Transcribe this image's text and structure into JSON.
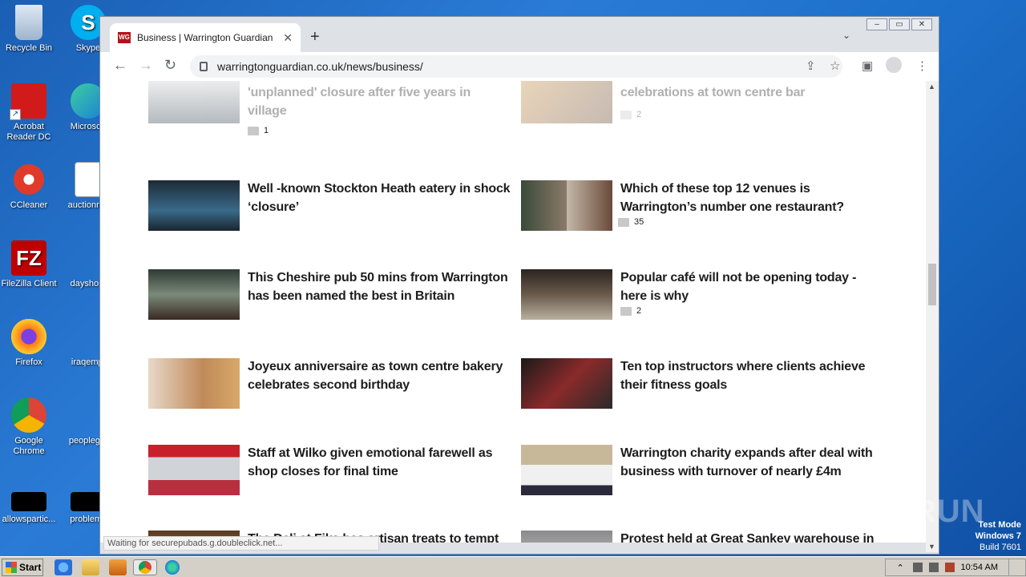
{
  "desktop": {
    "icons": [
      {
        "label": "Recycle Bin"
      },
      {
        "label": "Skype"
      },
      {
        "label": "Acrobat Reader DC"
      },
      {
        "label": "Microsoft"
      },
      {
        "label": "CCleaner"
      },
      {
        "label": "auctionme"
      },
      {
        "label": "FileZilla Client"
      },
      {
        "label": "dayshop."
      },
      {
        "label": "Firefox"
      },
      {
        "label": "iraqempl"
      },
      {
        "label": "Google Chrome"
      },
      {
        "label": "peopleget"
      },
      {
        "label": "allowspartic..."
      },
      {
        "label": "problems"
      }
    ]
  },
  "browser": {
    "tab_title": "Business | Warrington Guardian",
    "tab_favicon_text": "WG",
    "url": "warringtonguardian.co.uk/news/business/",
    "status_text": "Waiting for securepubads.g.doubleclick.net..."
  },
  "articles": [
    {
      "headline": "'unplanned' closure after five years in village",
      "comments": "1",
      "faded": true
    },
    {
      "headline": "celebrations at town centre bar",
      "comments": "2",
      "faded": true
    },
    {
      "headline": "Well -known Stockton Heath eatery in shock ‘closure’",
      "comments": ""
    },
    {
      "headline": "Which of these top 12 venues is Warrington’s number one restaurant?",
      "comments": "35"
    },
    {
      "headline": "This Cheshire pub 50 mins from Warrington has been named the best in Britain",
      "comments": ""
    },
    {
      "headline": "Popular café will not be opening today - here is why",
      "comments": "2"
    },
    {
      "headline": "Joyeux anniversaire as town centre bakery celebrates second birthday",
      "comments": ""
    },
    {
      "headline": "Ten top instructors where clients achieve their fitness goals",
      "comments": ""
    },
    {
      "headline": "Staff at Wilko given emotional farewell as shop closes for final time",
      "comments": ""
    },
    {
      "headline": "Warrington charity expands after deal with business with turnover of nearly £4m",
      "comments": ""
    },
    {
      "headline": "The Deli at Fika has artisan treats to tempt",
      "comments": ""
    },
    {
      "headline": "Protest held at Great Sankey warehouse in solidarity with 'sacked' workers",
      "comments": ""
    }
  ],
  "watermark": "ANY RUN",
  "testmode": {
    "line1": "Test Mode",
    "line2": "Windows 7",
    "line3": "Build 7601"
  },
  "taskbar": {
    "start_label": "Start",
    "clock": "10:54 AM"
  }
}
